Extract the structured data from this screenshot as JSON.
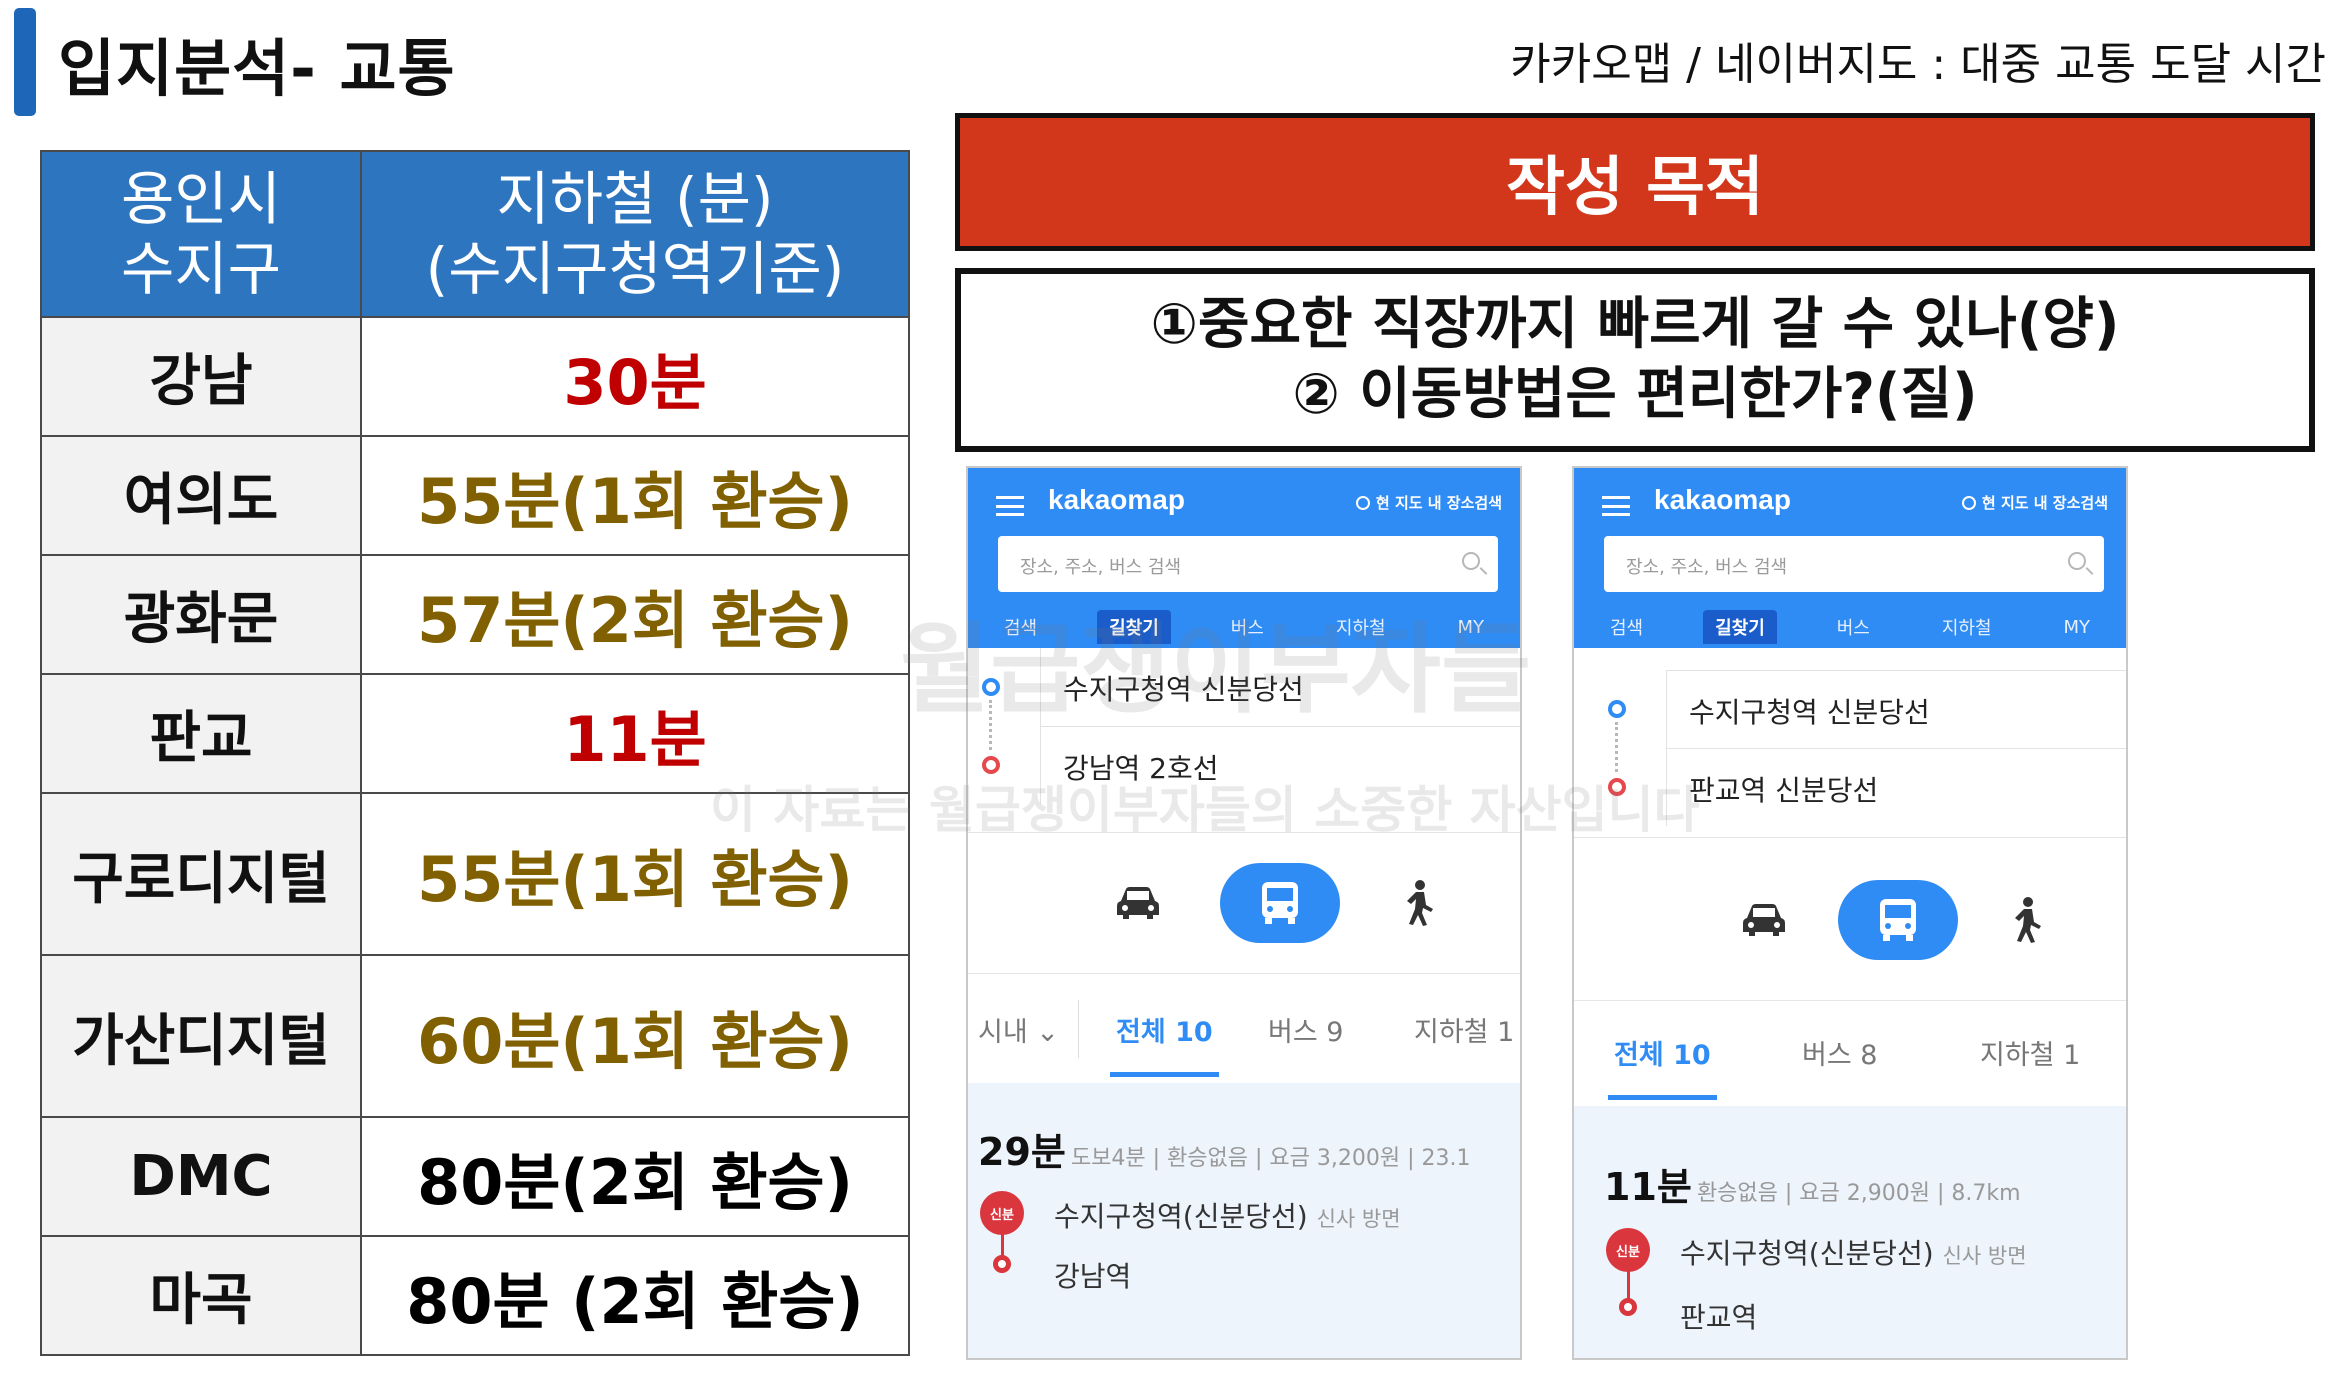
{
  "header": {
    "title": "입지분석-  교통",
    "subtitle": "카카오맵 / 네이버지도 : 대중 교통 도달 시간"
  },
  "table": {
    "header_col1": "용인시\n수지구",
    "header_col2": "지하철 (분)\n(수지구청역기준)",
    "rows": [
      {
        "place": "강남",
        "time": "30분",
        "color": "#c00000"
      },
      {
        "place": "여의도",
        "time": "55분(1회 환승)",
        "color": "#806000"
      },
      {
        "place": "광화문",
        "time": "57분(2회 환승)",
        "color": "#806000"
      },
      {
        "place": "판교",
        "time": "11분",
        "color": "#c00000"
      },
      {
        "place": "구로디지털",
        "time": "55분(1회 환승)",
        "color": "#806000"
      },
      {
        "place": "가산디지털",
        "time": "60분(1회 환승)",
        "color": "#806000"
      },
      {
        "place": "DMC",
        "time": "80분(2회 환승)",
        "color": "#000000"
      },
      {
        "place": "마곡",
        "time": "80분 (2회 환승)",
        "color": "#000000"
      }
    ]
  },
  "purpose": {
    "banner": "작성 목적",
    "line1": "①중요한 직장까지 빠르게 갈 수 있나(양)",
    "line2": "②  이동방법은 편리한가?(질)"
  },
  "phone1": {
    "brand": "kakaomap",
    "map_search": "현 지도 내 장소검색",
    "search_placeholder": "장소, 주소, 버스 검색",
    "nav": [
      "검색",
      "길찾기",
      "버스",
      "지하철",
      "MY"
    ],
    "origin": "수지구청역 신분당선",
    "destination": "강남역 2호선",
    "city_filter": "시내",
    "tabs": [
      "전체 10",
      "버스 9",
      "지하철 1"
    ],
    "duration": "29분",
    "meta": "도보4분 | 환승없음 | 요금 3,200원 | 23.1",
    "badge": "신분",
    "board_station": "수지구청역(신분당선)",
    "board_direction": "신사 방면",
    "alight_station": "강남역"
  },
  "phone2": {
    "brand": "kakaomap",
    "map_search": "현 지도 내 장소검색",
    "search_placeholder": "장소, 주소, 버스 검색",
    "nav": [
      "검색",
      "길찾기",
      "버스",
      "지하철",
      "MY"
    ],
    "origin": "수지구청역 신분당선",
    "destination": "판교역 신분당선",
    "tabs": [
      "전체 10",
      "버스 8",
      "지하철 1"
    ],
    "duration": "11분",
    "meta": "환승없음 | 요금 2,900원 | 8.7km",
    "badge": "신분",
    "board_station": "수지구청역(신분당선)",
    "board_direction": "신사 방면",
    "alight_station": "판교역"
  },
  "watermark": {
    "line1": "월급쟁이부자들",
    "line2": "이 자료는 월급쟁이부자들의 소중한 자산입니다"
  },
  "icons": [
    "menu-icon",
    "search-icon",
    "car-icon",
    "bus-icon",
    "walk-icon",
    "chevron-down-icon"
  ],
  "colors": {
    "accent": "#1e66b8",
    "table_header": "#2e75c0",
    "banner": "#d2371b",
    "kakao_blue": "#2f8cf4",
    "subway_red": "#d9363e"
  }
}
